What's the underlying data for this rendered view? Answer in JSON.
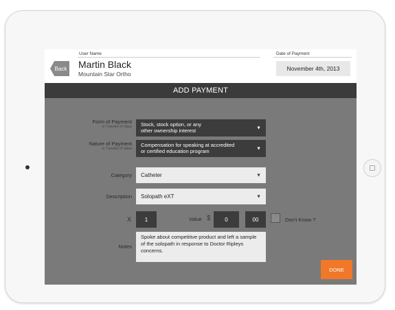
{
  "header": {
    "back_label": "Back",
    "user_label": "User Name",
    "user_name": "Martin Black",
    "user_org": "Mountain Star Ortho",
    "date_label": "Date of Payment",
    "date_value": "November 4th, 2013"
  },
  "title": "ADD PAYMENT",
  "form": {
    "form_of_payment": {
      "label": "Form of Payment",
      "sublabel": "or Transfer of Value",
      "value_line1": "Stock, stock option, or any",
      "value_line2": "other ownership interest"
    },
    "nature_of_payment": {
      "label": "Nature of Payment",
      "sublabel": "or Transfer of Value",
      "value_line1": "Compensation for speaking at accredited",
      "value_line2": "or certified education program"
    },
    "category": {
      "label": "Category",
      "value": "Catheter"
    },
    "description": {
      "label": "Description",
      "value": "Solopath eXT"
    },
    "quantity": {
      "label": "X",
      "value": "1"
    },
    "value": {
      "label": "Value",
      "currency": "$",
      "dollars": "0",
      "cents": "00"
    },
    "dont_know": {
      "label": "Don't Know ?",
      "checked": false
    },
    "notes": {
      "label": "Notes",
      "text": "Spoke about competitive product and left a sample of the solopath in response to Doctor Ripleys concerns."
    },
    "done_label": "DONE"
  },
  "colors": {
    "accent": "#f07828",
    "title_bar": "#3b3b3b",
    "form_bg": "#7a7a7a",
    "dark_field": "#3c3c3c",
    "light_field": "#ececec"
  },
  "icons": {
    "dropdown": "caret-down-icon",
    "back": "back-arrow-button",
    "home": "home-button"
  }
}
